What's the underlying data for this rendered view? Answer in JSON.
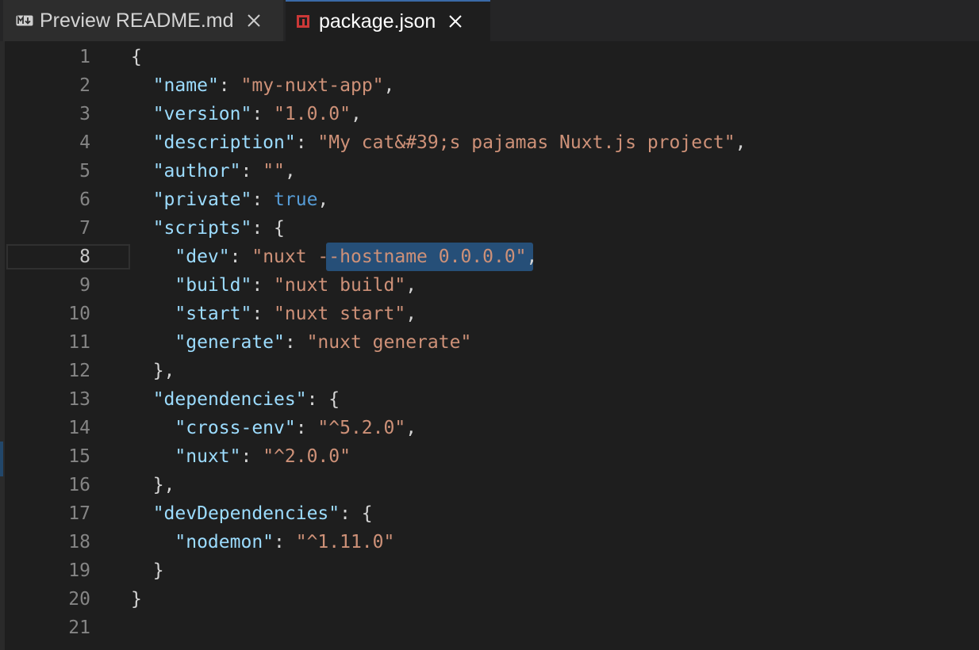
{
  "tabs": [
    {
      "label": "Preview README.md",
      "icon": "markdown-preview-icon",
      "active": false
    },
    {
      "label": "package.json",
      "icon": "npm-icon",
      "active": true
    }
  ],
  "editor": {
    "active_line": 8,
    "selected_text": "--hostname 0.0.0.0",
    "line_numbers": [
      "1",
      "2",
      "3",
      "4",
      "5",
      "6",
      "7",
      "8",
      "9",
      "10",
      "11",
      "12",
      "13",
      "14",
      "15",
      "16",
      "17",
      "18",
      "19",
      "20",
      "21"
    ],
    "lines": [
      {
        "indent": "",
        "tokens": [
          {
            "t": "p",
            "v": "{"
          }
        ]
      },
      {
        "indent": "  ",
        "tokens": [
          {
            "t": "k",
            "v": "\"name\""
          },
          {
            "t": "p",
            "v": ": "
          },
          {
            "t": "s",
            "v": "\"my-nuxt-app\""
          },
          {
            "t": "p",
            "v": ","
          }
        ]
      },
      {
        "indent": "  ",
        "tokens": [
          {
            "t": "k",
            "v": "\"version\""
          },
          {
            "t": "p",
            "v": ": "
          },
          {
            "t": "s",
            "v": "\"1.0.0\""
          },
          {
            "t": "p",
            "v": ","
          }
        ]
      },
      {
        "indent": "  ",
        "tokens": [
          {
            "t": "k",
            "v": "\"description\""
          },
          {
            "t": "p",
            "v": ": "
          },
          {
            "t": "s",
            "v": "\"My cat&#39;s pajamas Nuxt.js project\""
          },
          {
            "t": "p",
            "v": ","
          }
        ]
      },
      {
        "indent": "  ",
        "tokens": [
          {
            "t": "k",
            "v": "\"author\""
          },
          {
            "t": "p",
            "v": ": "
          },
          {
            "t": "s",
            "v": "\"\""
          },
          {
            "t": "p",
            "v": ","
          }
        ]
      },
      {
        "indent": "  ",
        "tokens": [
          {
            "t": "k",
            "v": "\"private\""
          },
          {
            "t": "p",
            "v": ": "
          },
          {
            "t": "b",
            "v": "true"
          },
          {
            "t": "p",
            "v": ","
          }
        ]
      },
      {
        "indent": "  ",
        "tokens": [
          {
            "t": "k",
            "v": "\"scripts\""
          },
          {
            "t": "p",
            "v": ": {"
          }
        ]
      },
      {
        "indent": "    ",
        "tokens": [
          {
            "t": "k",
            "v": "\"dev\""
          },
          {
            "t": "p",
            "v": ": "
          },
          {
            "t": "s",
            "v": "\"nuxt --hostname 0.0.0.0\""
          },
          {
            "t": "p",
            "v": ","
          }
        ]
      },
      {
        "indent": "    ",
        "tokens": [
          {
            "t": "k",
            "v": "\"build\""
          },
          {
            "t": "p",
            "v": ": "
          },
          {
            "t": "s",
            "v": "\"nuxt build\""
          },
          {
            "t": "p",
            "v": ","
          }
        ]
      },
      {
        "indent": "    ",
        "tokens": [
          {
            "t": "k",
            "v": "\"start\""
          },
          {
            "t": "p",
            "v": ": "
          },
          {
            "t": "s",
            "v": "\"nuxt start\""
          },
          {
            "t": "p",
            "v": ","
          }
        ]
      },
      {
        "indent": "    ",
        "tokens": [
          {
            "t": "k",
            "v": "\"generate\""
          },
          {
            "t": "p",
            "v": ": "
          },
          {
            "t": "s",
            "v": "\"nuxt generate\""
          }
        ]
      },
      {
        "indent": "  ",
        "tokens": [
          {
            "t": "p",
            "v": "},"
          }
        ]
      },
      {
        "indent": "  ",
        "tokens": [
          {
            "t": "k",
            "v": "\"dependencies\""
          },
          {
            "t": "p",
            "v": ": {"
          }
        ]
      },
      {
        "indent": "    ",
        "tokens": [
          {
            "t": "k",
            "v": "\"cross-env\""
          },
          {
            "t": "p",
            "v": ": "
          },
          {
            "t": "s",
            "v": "\"^5.2.0\""
          },
          {
            "t": "p",
            "v": ","
          }
        ]
      },
      {
        "indent": "    ",
        "tokens": [
          {
            "t": "k",
            "v": "\"nuxt\""
          },
          {
            "t": "p",
            "v": ": "
          },
          {
            "t": "s",
            "v": "\"^2.0.0\""
          }
        ]
      },
      {
        "indent": "  ",
        "tokens": [
          {
            "t": "p",
            "v": "},"
          }
        ]
      },
      {
        "indent": "  ",
        "tokens": [
          {
            "t": "k",
            "v": "\"devDependencies\""
          },
          {
            "t": "p",
            "v": ": {"
          }
        ]
      },
      {
        "indent": "    ",
        "tokens": [
          {
            "t": "k",
            "v": "\"nodemon\""
          },
          {
            "t": "p",
            "v": ": "
          },
          {
            "t": "s",
            "v": "\"^1.11.0\""
          }
        ]
      },
      {
        "indent": "  ",
        "tokens": [
          {
            "t": "p",
            "v": "}"
          }
        ]
      },
      {
        "indent": "",
        "tokens": [
          {
            "t": "p",
            "v": "}"
          }
        ]
      },
      {
        "indent": "",
        "tokens": []
      }
    ]
  },
  "colors": {
    "editor_background": "#1e1e1e",
    "json_key": "#9cdcfe",
    "json_string": "#ce9178",
    "json_boolean": "#569cd6",
    "punctuation": "#d4d4d4",
    "selection": "#264f78",
    "npm_icon": "#cb3837"
  }
}
